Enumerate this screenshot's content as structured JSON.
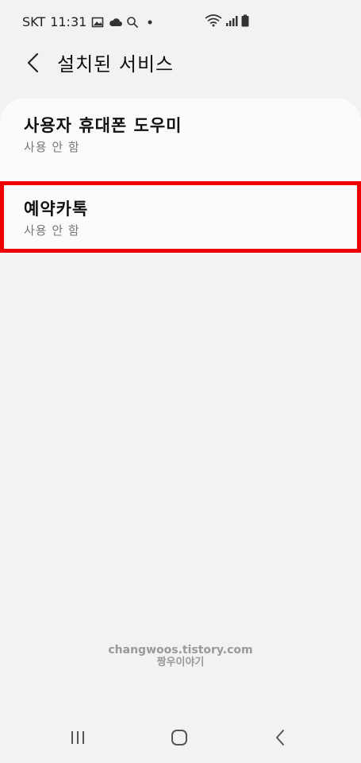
{
  "status_bar": {
    "carrier": "SKT",
    "time": "11:31",
    "icons": [
      "image-icon",
      "cloud-icon",
      "search-icon",
      "dot-icon",
      "wifi-icon",
      "signal-icon",
      "battery-icon"
    ]
  },
  "header": {
    "title": "설치된 서비스",
    "back_icon": "back-arrow-icon"
  },
  "services": [
    {
      "title": "사용자 휴대폰 도우미",
      "status": "사용 안 함",
      "highlighted": false
    },
    {
      "title": "예약카톡",
      "status": "사용 안 함",
      "highlighted": true
    }
  ],
  "watermark": {
    "line1": "changwoos.tistory.com",
    "line2": "짱우이야기"
  },
  "nav_bar": {
    "icons": [
      "recents-icon",
      "home-icon",
      "back-icon"
    ]
  },
  "colors": {
    "background": "#f2f2f2",
    "card": "#fbfbfb",
    "highlight": "#ee0000",
    "subtitle": "#777777"
  }
}
